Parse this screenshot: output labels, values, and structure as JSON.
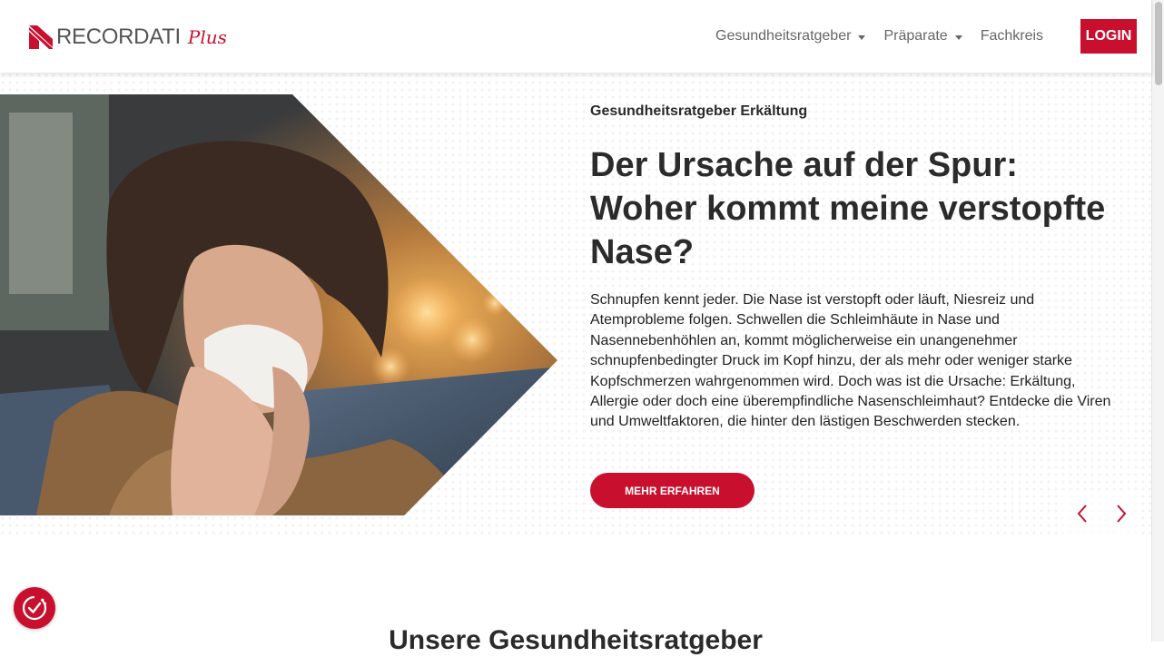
{
  "brand": {
    "name": "RECORDATI",
    "suffix": "Plus",
    "accent_color": "#c8102e"
  },
  "nav": {
    "items": [
      {
        "label": "Gesundheitsratgeber",
        "dropdown": true
      },
      {
        "label": "Präparate",
        "dropdown": true
      },
      {
        "label": "Fachkreis",
        "dropdown": false
      }
    ],
    "login_label": "LOGIN"
  },
  "hero": {
    "eyebrow": "Gesundheitsratgeber Erkältung",
    "title": "Der Ursache auf der Spur: Woher kommt meine verstopfte Nase?",
    "text": "Schnupfen kennt jeder. Die Nase ist verstopft oder läuft, Niesreiz und Atemprobleme folgen. Schwellen die Schleimhäute in Nase und Nasennebenhöhlen an, kommt möglicherweise ein unangenehmer schnupfenbedingter Druck im Kopf hinzu, der als mehr oder weniger starke Kopfschmerzen wahrgenommen wird. Doch was ist die Ursache: Erkältung, Allergie oder doch eine überempfindliche Nasenschleimhaut? Entdecke die Viren und Umweltfaktoren, die hinter den lästigen Beschwerden stecken.",
    "cta_label": "MEHR ERFAHREN",
    "image_icon": "woman-sneezing-photo"
  },
  "slider": {
    "prev_icon": "chevron-left-icon",
    "next_icon": "chevron-right-icon"
  },
  "section": {
    "title": "Unsere Gesundheitsratgeber"
  },
  "accessibility": {
    "icon": "accessibility-check-icon"
  }
}
